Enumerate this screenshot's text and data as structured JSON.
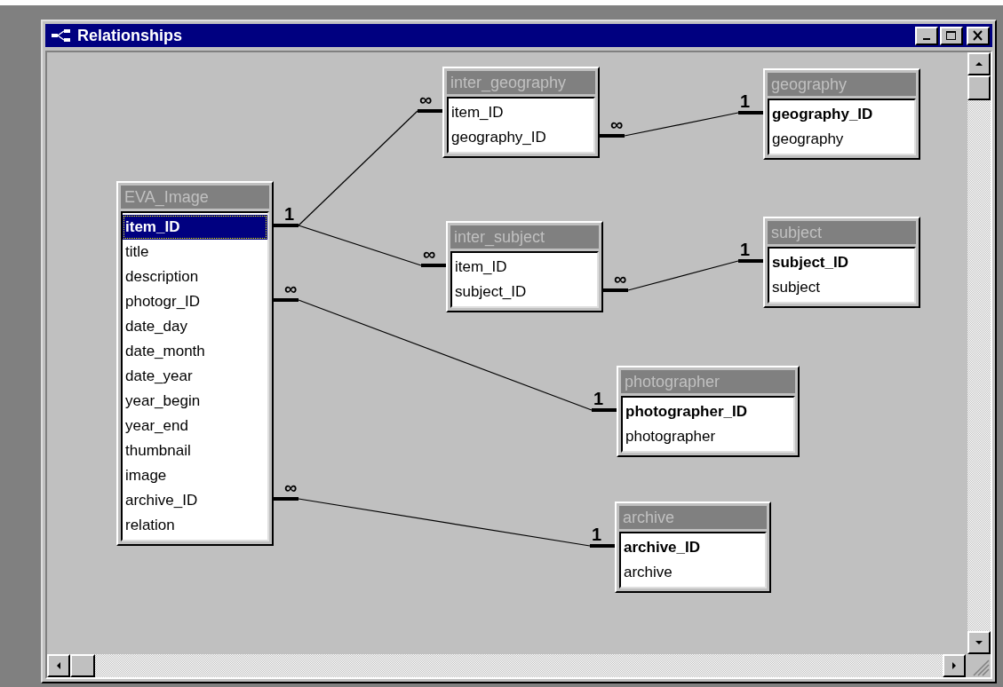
{
  "window": {
    "title": "Relationships"
  },
  "tables": [
    {
      "name": "EVA_Image",
      "fields": [
        {
          "name": "item_ID",
          "primary_key": true,
          "selected": true
        },
        {
          "name": "title",
          "primary_key": false,
          "selected": false
        },
        {
          "name": "description",
          "primary_key": false,
          "selected": false
        },
        {
          "name": "photogr_ID",
          "primary_key": false,
          "selected": false
        },
        {
          "name": "date_day",
          "primary_key": false,
          "selected": false
        },
        {
          "name": "date_month",
          "primary_key": false,
          "selected": false
        },
        {
          "name": "date_year",
          "primary_key": false,
          "selected": false
        },
        {
          "name": "year_begin",
          "primary_key": false,
          "selected": false
        },
        {
          "name": "year_end",
          "primary_key": false,
          "selected": false
        },
        {
          "name": "thumbnail",
          "primary_key": false,
          "selected": false
        },
        {
          "name": "image",
          "primary_key": false,
          "selected": false
        },
        {
          "name": "archive_ID",
          "primary_key": false,
          "selected": false
        },
        {
          "name": "relation",
          "primary_key": false,
          "selected": false
        }
      ]
    },
    {
      "name": "inter_geography",
      "fields": [
        {
          "name": "item_ID",
          "primary_key": false,
          "selected": false
        },
        {
          "name": "geography_ID",
          "primary_key": false,
          "selected": false
        }
      ]
    },
    {
      "name": "geography",
      "fields": [
        {
          "name": "geography_ID",
          "primary_key": true,
          "selected": false
        },
        {
          "name": "geography",
          "primary_key": false,
          "selected": false
        }
      ]
    },
    {
      "name": "inter_subject",
      "fields": [
        {
          "name": "item_ID",
          "primary_key": false,
          "selected": false
        },
        {
          "name": "subject_ID",
          "primary_key": false,
          "selected": false
        }
      ]
    },
    {
      "name": "subject",
      "fields": [
        {
          "name": "subject_ID",
          "primary_key": true,
          "selected": false
        },
        {
          "name": "subject",
          "primary_key": false,
          "selected": false
        }
      ]
    },
    {
      "name": "photographer",
      "fields": [
        {
          "name": "photographer_ID",
          "primary_key": true,
          "selected": false
        },
        {
          "name": "photographer",
          "primary_key": false,
          "selected": false
        }
      ]
    },
    {
      "name": "archive",
      "fields": [
        {
          "name": "archive_ID",
          "primary_key": true,
          "selected": false
        },
        {
          "name": "archive",
          "primary_key": false,
          "selected": false
        }
      ]
    }
  ],
  "relationships": [
    {
      "from_label": "1",
      "to_label": "∞"
    },
    {
      "to_label": "∞"
    },
    {
      "from_label": "∞",
      "to_label": "1"
    },
    {
      "from_label": "∞",
      "to_label": "1"
    },
    {
      "from_label": "∞",
      "to_label": "1"
    },
    {
      "from_label": "∞",
      "to_label": "1"
    }
  ]
}
